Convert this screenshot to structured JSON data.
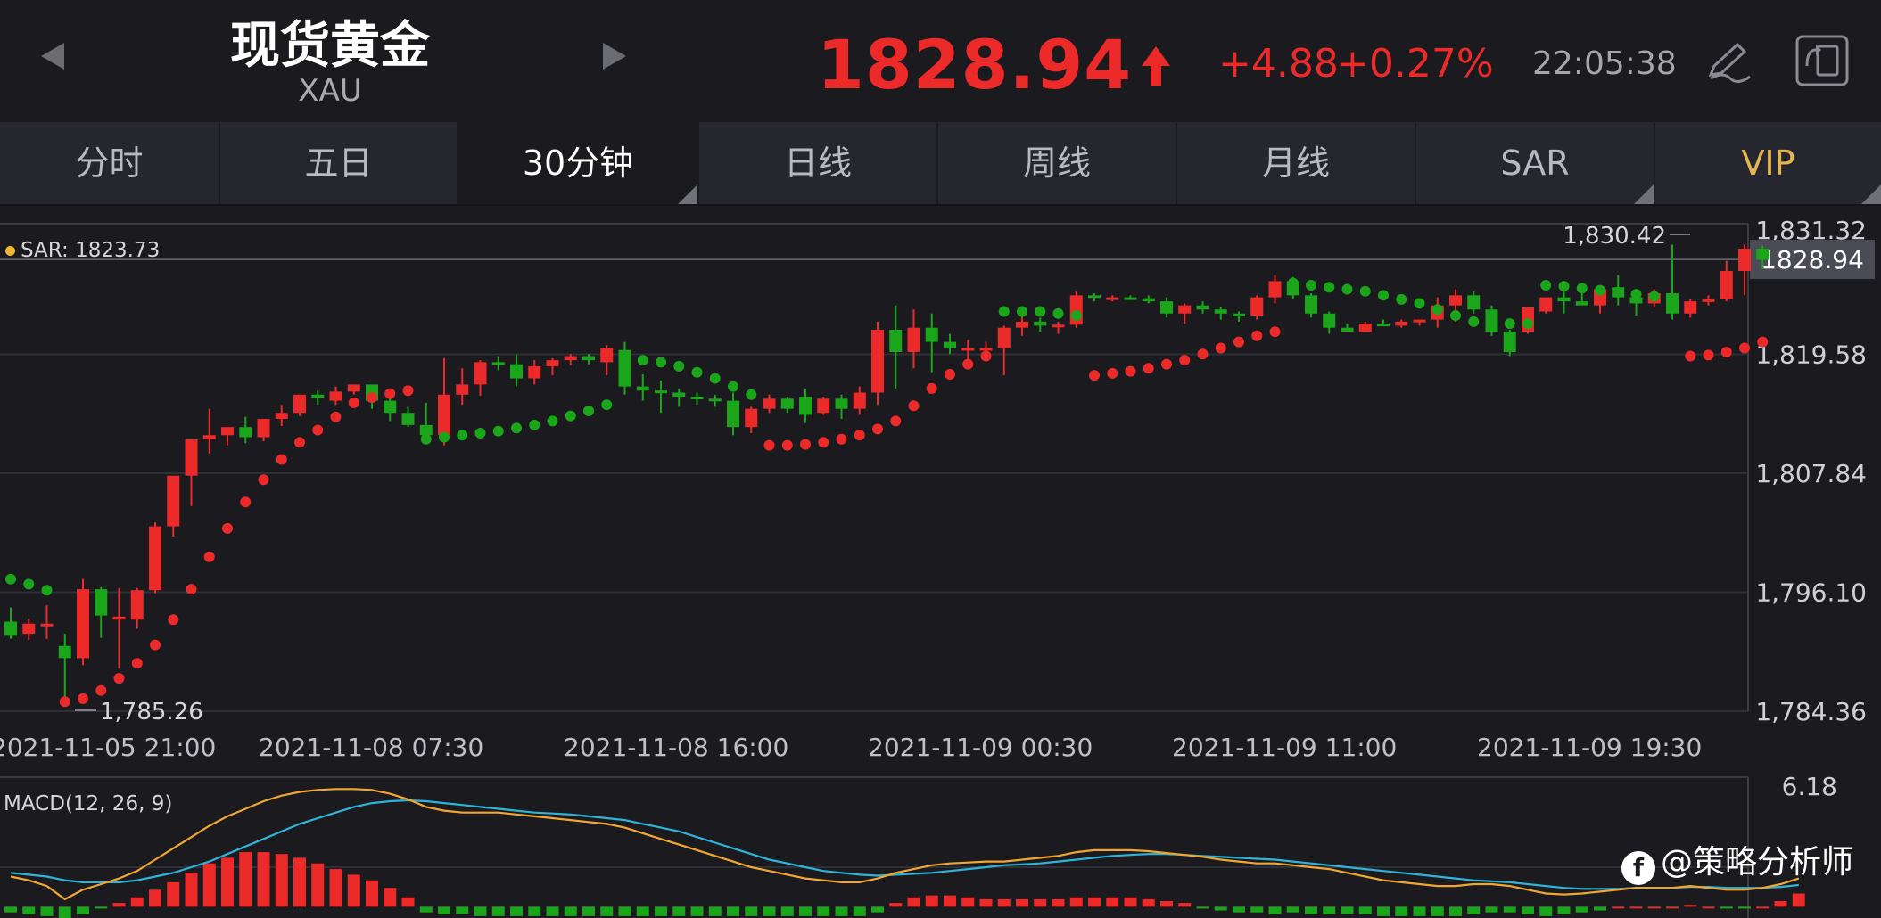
{
  "header": {
    "title": "现货黄金",
    "subtitle": "XAU",
    "price": "1828.94",
    "change": "+4.88",
    "change_pct": "+0.27%",
    "time": "22:05:38",
    "prev_icon": "triangle-left-icon",
    "next_icon": "triangle-right-icon",
    "up_icon": "arrow-up-icon",
    "edit_icon": "pen-icon",
    "rotate_icon": "screen-rotate-icon"
  },
  "tabs": [
    {
      "label": "分时"
    },
    {
      "label": "五日"
    },
    {
      "label": "30分钟"
    },
    {
      "label": "日线"
    },
    {
      "label": "周线"
    },
    {
      "label": "月线"
    },
    {
      "label": "SAR"
    },
    {
      "label": "VIP"
    }
  ],
  "colors": {
    "up": "#ec2a2a",
    "down": "#1aa51a",
    "background": "#1a1a1f",
    "grid": "#33343c",
    "macd_dif": "#2fb3d8",
    "macd_dea": "#f2a631",
    "vip": "#e6b451"
  },
  "indicator": {
    "sar_label": "SAR: 1823.73",
    "macd_label": "MACD(12, 26, 9)"
  },
  "watermark": "@策略分析师",
  "chart_data": {
    "type": "candlestick",
    "title": "",
    "timeframe": "30分钟",
    "y_ticks": [
      1831.32,
      1819.58,
      1807.84,
      1796.1,
      1784.36
    ],
    "y_tick_labels": [
      "1,831.32",
      "1,819.58",
      "1,807.84",
      "1,796.10",
      "1,784.36"
    ],
    "ylim": [
      1784.36,
      1831.32
    ],
    "x_tick_labels": [
      "2021-11-05 21:00",
      "2021-11-08 07:30",
      "2021-11-08 16:00",
      "2021-11-09 00:30",
      "2021-11-09 11:00",
      "2021-11-09 19:30"
    ],
    "last_price": 1828.94,
    "last_price_label": "1828.94",
    "max_label": "1,830.42",
    "min_label": "1,785.26",
    "candles": [
      [
        1793.2,
        1794.6,
        1791.5,
        1791.8
      ],
      [
        1792.0,
        1793.5,
        1791.4,
        1793.0
      ],
      [
        1793.0,
        1794.8,
        1791.5,
        1793.0
      ],
      [
        1790.8,
        1792.0,
        1785.6,
        1789.6
      ],
      [
        1789.6,
        1797.4,
        1788.9,
        1796.4
      ],
      [
        1796.4,
        1796.6,
        1791.6,
        1793.8
      ],
      [
        1793.4,
        1796.5,
        1788.6,
        1793.7
      ],
      [
        1793.4,
        1796.5,
        1792.5,
        1796.3
      ],
      [
        1796.3,
        1803.0,
        1796.0,
        1802.6
      ],
      [
        1802.6,
        1806.0,
        1801.6,
        1807.6
      ],
      [
        1807.6,
        1810.2,
        1804.6,
        1811.2
      ],
      [
        1811.2,
        1814.2,
        1809.8,
        1811.6
      ],
      [
        1811.6,
        1812.2,
        1810.6,
        1812.4
      ],
      [
        1812.4,
        1813.4,
        1810.8,
        1811.4
      ],
      [
        1811.4,
        1813.2,
        1811.0,
        1813.2
      ],
      [
        1813.2,
        1814.6,
        1812.5,
        1813.8
      ],
      [
        1813.8,
        1815.6,
        1813.5,
        1815.6
      ],
      [
        1815.6,
        1816.0,
        1814.6,
        1815.3
      ],
      [
        1815.0,
        1816.4,
        1814.6,
        1815.9
      ],
      [
        1815.9,
        1816.6,
        1815.6,
        1816.6
      ],
      [
        1816.6,
        1816.6,
        1814.2,
        1815.0
      ],
      [
        1815.0,
        1815.6,
        1813.0,
        1813.8
      ],
      [
        1813.8,
        1814.4,
        1812.4,
        1812.6
      ],
      [
        1812.6,
        1814.8,
        1810.8,
        1811.6
      ],
      [
        1811.6,
        1819.2,
        1810.6,
        1815.6
      ],
      [
        1815.6,
        1818.2,
        1814.6,
        1816.6
      ],
      [
        1816.6,
        1819.0,
        1815.5,
        1818.8
      ],
      [
        1818.8,
        1819.4,
        1818.0,
        1818.6
      ],
      [
        1818.6,
        1819.6,
        1816.4,
        1817.2
      ],
      [
        1817.2,
        1819.0,
        1816.6,
        1818.4
      ],
      [
        1818.4,
        1819.2,
        1817.5,
        1819.0
      ],
      [
        1819.0,
        1819.6,
        1818.5,
        1819.4
      ],
      [
        1819.4,
        1819.6,
        1818.6,
        1819.0
      ],
      [
        1818.8,
        1820.5,
        1817.5,
        1820.2
      ],
      [
        1820.0,
        1820.8,
        1815.6,
        1816.4
      ],
      [
        1816.4,
        1817.6,
        1815.0,
        1816.0
      ],
      [
        1816.0,
        1817.0,
        1813.8,
        1815.8
      ],
      [
        1815.8,
        1816.2,
        1814.4,
        1815.4
      ],
      [
        1815.4,
        1815.8,
        1814.6,
        1815.2
      ],
      [
        1815.2,
        1815.6,
        1814.4,
        1815.0
      ],
      [
        1815.0,
        1815.8,
        1811.6,
        1812.4
      ],
      [
        1812.4,
        1814.4,
        1811.8,
        1814.2
      ],
      [
        1814.2,
        1815.6,
        1813.8,
        1815.2
      ],
      [
        1815.2,
        1815.4,
        1813.8,
        1814.2
      ],
      [
        1815.4,
        1816.2,
        1812.8,
        1813.6
      ],
      [
        1813.8,
        1815.4,
        1813.6,
        1815.2
      ],
      [
        1815.2,
        1815.6,
        1813.2,
        1814.2
      ],
      [
        1814.2,
        1816.4,
        1813.6,
        1815.8
      ],
      [
        1815.8,
        1822.8,
        1814.6,
        1822.0
      ],
      [
        1822.0,
        1824.4,
        1816.2,
        1819.8
      ],
      [
        1819.8,
        1824.0,
        1818.2,
        1822.2
      ],
      [
        1822.2,
        1823.6,
        1817.8,
        1820.8
      ],
      [
        1820.8,
        1821.6,
        1819.6,
        1820.2
      ],
      [
        1820.2,
        1821.0,
        1818.4,
        1820.2
      ],
      [
        1820.2,
        1820.8,
        1819.8,
        1820.2
      ],
      [
        1820.2,
        1822.4,
        1817.5,
        1822.2
      ],
      [
        1822.2,
        1823.8,
        1821.4,
        1822.8
      ],
      [
        1822.8,
        1823.2,
        1821.8,
        1822.4
      ],
      [
        1822.4,
        1822.8,
        1821.6,
        1822.5
      ],
      [
        1822.5,
        1825.8,
        1822.2,
        1825.4
      ],
      [
        1825.4,
        1825.6,
        1824.8,
        1825.2
      ],
      [
        1825.2,
        1825.4,
        1824.8,
        1825.2
      ],
      [
        1825.2,
        1825.4,
        1825.0,
        1825.1
      ],
      [
        1825.1,
        1825.4,
        1824.6,
        1824.8
      ],
      [
        1824.8,
        1825.2,
        1823.2,
        1823.6
      ],
      [
        1823.6,
        1824.6,
        1822.6,
        1824.4
      ],
      [
        1824.4,
        1824.8,
        1823.6,
        1824.0
      ],
      [
        1824.0,
        1824.2,
        1823.0,
        1823.6
      ],
      [
        1823.6,
        1823.8,
        1822.8,
        1823.4
      ],
      [
        1823.4,
        1825.4,
        1823.0,
        1825.2
      ],
      [
        1825.2,
        1827.4,
        1824.6,
        1826.8
      ],
      [
        1826.8,
        1827.2,
        1825.0,
        1825.4
      ],
      [
        1825.4,
        1825.6,
        1823.2,
        1823.6
      ],
      [
        1823.6,
        1823.8,
        1821.6,
        1822.2
      ],
      [
        1822.2,
        1822.6,
        1821.8,
        1821.8
      ],
      [
        1821.8,
        1822.8,
        1821.8,
        1822.6
      ],
      [
        1822.6,
        1823.0,
        1822.4,
        1822.4
      ],
      [
        1822.4,
        1823.0,
        1822.2,
        1822.8
      ],
      [
        1822.8,
        1823.0,
        1822.4,
        1823.0
      ],
      [
        1823.0,
        1825.2,
        1822.2,
        1824.4
      ],
      [
        1824.4,
        1826.0,
        1822.8,
        1825.4
      ],
      [
        1825.4,
        1825.8,
        1823.6,
        1824.0
      ],
      [
        1824.0,
        1824.4,
        1821.4,
        1821.8
      ],
      [
        1821.8,
        1822.0,
        1819.4,
        1819.8
      ],
      [
        1821.8,
        1824.0,
        1821.6,
        1824.2
      ],
      [
        1823.8,
        1824.2,
        1823.6,
        1825.2
      ],
      [
        1825.2,
        1826.0,
        1823.6,
        1824.8
      ],
      [
        1824.8,
        1825.6,
        1824.6,
        1824.4
      ],
      [
        1824.4,
        1826.4,
        1823.6,
        1826.0
      ],
      [
        1826.2,
        1827.4,
        1824.4,
        1825.2
      ],
      [
        1825.2,
        1825.8,
        1823.4,
        1824.6
      ],
      [
        1824.6,
        1826.0,
        1824.2,
        1825.6
      ],
      [
        1825.6,
        1830.4,
        1823.0,
        1823.6
      ],
      [
        1823.6,
        1825.0,
        1823.2,
        1824.8
      ],
      [
        1824.8,
        1825.4,
        1824.4,
        1825.0
      ],
      [
        1825.0,
        1828.8,
        1824.8,
        1827.8
      ],
      [
        1827.8,
        1830.4,
        1825.4,
        1830.0
      ],
      [
        1830.0,
        1830.3,
        1828.0,
        1828.9
      ]
    ],
    "sar": [
      1797.4,
      1796.9,
      1796.3,
      1785.3,
      1785.6,
      1786.4,
      1787.6,
      1789.1,
      1790.9,
      1793.4,
      1796.4,
      1799.6,
      1802.4,
      1805.0,
      1807.2,
      1809.2,
      1810.9,
      1812.1,
      1813.4,
      1814.8,
      1815.3,
      1815.7,
      1816.0,
      1811.2,
      1811.4,
      1811.6,
      1811.8,
      1812.0,
      1812.3,
      1812.6,
      1813.0,
      1813.5,
      1814.0,
      1814.6,
      1819.2,
      1819.0,
      1818.8,
      1818.4,
      1817.8,
      1817.2,
      1816.4,
      1815.6,
      1810.6,
      1810.6,
      1810.7,
      1810.9,
      1811.2,
      1811.6,
      1812.2,
      1813.0,
      1814.5,
      1816.2,
      1817.6,
      1818.6,
      1819.4,
      1823.8,
      1823.8,
      1823.8,
      1823.6,
      1823.4,
      1817.5,
      1817.7,
      1817.9,
      1818.2,
      1818.6,
      1819.0,
      1819.6,
      1820.2,
      1820.8,
      1821.4,
      1821.8,
      1826.6,
      1826.4,
      1826.2,
      1826.0,
      1825.8,
      1825.4,
      1825.0,
      1824.6,
      1824.0,
      1823.4,
      1822.8,
      1822.4,
      1822.6,
      1822.6,
      1826.4,
      1826.3,
      1826.1,
      1825.9,
      1825.7,
      1825.5,
      1825.3,
      1825.0,
      1819.4,
      1819.5,
      1819.8,
      1820.2,
      1820.8,
      1821.6,
      1822.8
    ],
    "sar_trend": [
      "down",
      "down",
      "down",
      "up",
      "up",
      "up",
      "up",
      "up",
      "up",
      "up",
      "up",
      "up",
      "up",
      "up",
      "up",
      "up",
      "up",
      "up",
      "up",
      "up",
      "up",
      "up",
      "up",
      "down",
      "down",
      "down",
      "down",
      "down",
      "down",
      "down",
      "down",
      "down",
      "down",
      "down",
      "down",
      "down",
      "down",
      "down",
      "down",
      "down",
      "down",
      "down",
      "up",
      "up",
      "up",
      "up",
      "up",
      "up",
      "up",
      "up",
      "up",
      "up",
      "up",
      "up",
      "up",
      "down",
      "down",
      "down",
      "down",
      "down",
      "up",
      "up",
      "up",
      "up",
      "up",
      "up",
      "up",
      "up",
      "up",
      "up",
      "up",
      "down",
      "down",
      "down",
      "down",
      "down",
      "down",
      "down",
      "down",
      "down",
      "down",
      "down",
      "down",
      "down",
      "down",
      "down",
      "down",
      "down",
      "down",
      "down",
      "down",
      "down",
      "down",
      "up",
      "up",
      "up",
      "up",
      "up",
      "up",
      "up"
    ],
    "macd": {
      "label": "MACD(12, 26, 9)",
      "y_tick_labels": [
        "6.18"
      ],
      "ylim": [
        -0.6,
        6.5
      ],
      "dif": [
        1.6,
        1.4,
        1.1,
        0.4,
        0.9,
        1.2,
        1.5,
        1.9,
        2.5,
        3.1,
        3.7,
        4.3,
        4.8,
        5.2,
        5.6,
        5.9,
        6.1,
        6.2,
        6.25,
        6.25,
        6.2,
        6.0,
        5.7,
        5.3,
        5.1,
        5.0,
        5.0,
        5.0,
        4.9,
        4.8,
        4.7,
        4.6,
        4.5,
        4.4,
        4.2,
        3.9,
        3.6,
        3.3,
        3.0,
        2.7,
        2.4,
        2.1,
        1.9,
        1.7,
        1.5,
        1.4,
        1.3,
        1.3,
        1.5,
        1.8,
        2.0,
        2.2,
        2.3,
        2.35,
        2.4,
        2.4,
        2.5,
        2.6,
        2.7,
        2.9,
        3.0,
        3.0,
        3.0,
        2.95,
        2.85,
        2.75,
        2.65,
        2.5,
        2.4,
        2.3,
        2.3,
        2.2,
        2.1,
        2.0,
        1.8,
        1.6,
        1.4,
        1.3,
        1.2,
        1.1,
        1.1,
        1.2,
        1.2,
        1.1,
        0.9,
        0.7,
        0.65,
        0.7,
        0.8,
        0.9,
        1.0,
        1.0,
        1.0,
        1.1,
        1.0,
        0.9,
        0.9,
        1.0,
        1.2,
        1.5
      ],
      "dea": [
        1.8,
        1.7,
        1.6,
        1.4,
        1.3,
        1.3,
        1.3,
        1.4,
        1.6,
        1.8,
        2.1,
        2.4,
        2.8,
        3.2,
        3.6,
        4.0,
        4.4,
        4.7,
        5.0,
        5.3,
        5.5,
        5.6,
        5.65,
        5.6,
        5.5,
        5.4,
        5.3,
        5.2,
        5.1,
        5.0,
        4.95,
        4.9,
        4.8,
        4.7,
        4.6,
        4.4,
        4.2,
        4.0,
        3.7,
        3.4,
        3.1,
        2.8,
        2.5,
        2.3,
        2.1,
        1.9,
        1.8,
        1.7,
        1.65,
        1.7,
        1.75,
        1.8,
        1.9,
        2.0,
        2.1,
        2.2,
        2.25,
        2.3,
        2.4,
        2.5,
        2.6,
        2.7,
        2.75,
        2.8,
        2.8,
        2.75,
        2.7,
        2.65,
        2.6,
        2.55,
        2.5,
        2.4,
        2.3,
        2.2,
        2.1,
        2.0,
        1.9,
        1.8,
        1.7,
        1.6,
        1.5,
        1.4,
        1.35,
        1.3,
        1.2,
        1.1,
        1.0,
        0.95,
        0.95,
        0.95,
        1.0,
        1.0,
        1.0,
        1.05,
        1.05,
        1.0,
        1.0,
        1.0,
        1.05,
        1.15
      ],
      "hist": [
        -0.3,
        -0.4,
        -0.5,
        -0.9,
        -0.4,
        -0.1,
        0.2,
        0.5,
        0.9,
        1.3,
        1.8,
        2.3,
        2.6,
        2.9,
        2.9,
        2.8,
        2.6,
        2.3,
        2.0,
        1.7,
        1.4,
        1.0,
        0.5,
        -0.3,
        -0.4,
        -0.4,
        -0.5,
        -0.5,
        -0.5,
        -0.5,
        -0.5,
        -0.5,
        -0.5,
        -0.5,
        -0.5,
        -0.5,
        -0.5,
        -0.5,
        -0.5,
        -0.5,
        -0.5,
        -0.5,
        -0.5,
        -0.5,
        -0.5,
        -0.5,
        -0.5,
        -0.5,
        -0.3,
        0.2,
        0.5,
        0.6,
        0.6,
        0.5,
        0.4,
        0.4,
        0.4,
        0.4,
        0.4,
        0.5,
        0.5,
        0.5,
        0.5,
        0.4,
        0.3,
        0.2,
        -0.1,
        -0.2,
        -0.3,
        -0.3,
        -0.4,
        -0.3,
        -0.4,
        -0.4,
        -0.4,
        -0.4,
        -0.5,
        -0.5,
        -0.5,
        -0.5,
        -0.5,
        -0.4,
        -0.3,
        -0.3,
        -0.4,
        -0.5,
        -0.4,
        -0.3,
        -0.2,
        0.0,
        0.0,
        0.0,
        0.0,
        0.1,
        0.0,
        -0.1,
        -0.1,
        0.0,
        0.3,
        0.7
      ]
    }
  }
}
